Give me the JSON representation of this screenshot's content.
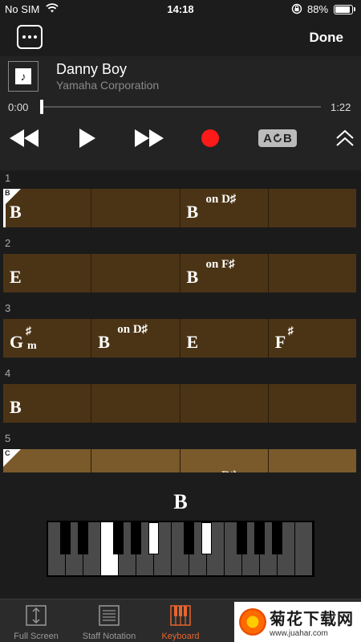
{
  "status_bar": {
    "carrier": "No SIM",
    "time": "14:18",
    "battery": "88%",
    "battery_level": 0.88
  },
  "nav": {
    "done_label": "Done"
  },
  "player": {
    "title": "Danny Boy",
    "artist": "Yamaha Corporation",
    "elapsed": "0:00",
    "total": "1:22",
    "progress": 0.0,
    "ab_label_a": "A",
    "ab_label_b": "B"
  },
  "chords": {
    "measures": [
      {
        "number": "1",
        "section": "B",
        "cells": [
          {
            "root": "B",
            "on": "",
            "accidental": "",
            "minor": false
          },
          {
            "root": "",
            "on": "",
            "accidental": "",
            "minor": false
          },
          {
            "root": "B",
            "on": "on D♯",
            "accidental": "",
            "minor": false
          },
          {
            "root": "",
            "on": "",
            "accidental": "",
            "minor": false
          }
        ]
      },
      {
        "number": "2",
        "section": "",
        "cells": [
          {
            "root": "E",
            "on": "",
            "accidental": "",
            "minor": false
          },
          {
            "root": "",
            "on": "",
            "accidental": "",
            "minor": false
          },
          {
            "root": "B",
            "on": "on F♯",
            "accidental": "",
            "minor": false
          },
          {
            "root": "",
            "on": "",
            "accidental": "",
            "minor": false
          }
        ]
      },
      {
        "number": "3",
        "section": "",
        "cells": [
          {
            "root": "G",
            "on": "",
            "accidental": "♯",
            "minor": true,
            "minor_label": "m"
          },
          {
            "root": "B",
            "on": "on D♯",
            "accidental": "",
            "minor": false
          },
          {
            "root": "E",
            "on": "",
            "accidental": "",
            "minor": false
          },
          {
            "root": "F",
            "on": "",
            "accidental": "♯",
            "minor": false
          }
        ]
      },
      {
        "number": "4",
        "section": "",
        "cells": [
          {
            "root": "B",
            "on": "",
            "accidental": "",
            "minor": false
          },
          {
            "root": "",
            "on": "",
            "accidental": "",
            "minor": false
          },
          {
            "root": "",
            "on": "",
            "accidental": "",
            "minor": false
          },
          {
            "root": "",
            "on": "",
            "accidental": "",
            "minor": false
          }
        ]
      },
      {
        "number": "5",
        "section": "C",
        "cells": [
          {
            "root": "",
            "on": "",
            "accidental": "",
            "minor": false
          },
          {
            "root": "",
            "on": "",
            "accidental": "",
            "minor": false
          },
          {
            "root": "",
            "on": "on D♯",
            "accidental": "",
            "minor": false
          },
          {
            "root": "",
            "on": "",
            "accidental": "",
            "minor": false
          }
        ]
      }
    ]
  },
  "keyboard": {
    "current_chord": "B",
    "white_keys_on": [
      3
    ],
    "black_keys_on": [
      4,
      6
    ]
  },
  "tabs": [
    {
      "label": "Full Screen",
      "icon": "full-screen-icon",
      "active": false
    },
    {
      "label": "Staff Notation",
      "icon": "staff-notation-icon",
      "active": false
    },
    {
      "label": "Keyboard",
      "icon": "keyboard-icon",
      "active": true
    }
  ],
  "watermark": {
    "text": "菊花下载网",
    "url": "www.juahar.com"
  },
  "colors": {
    "accent": "#e8652d",
    "record": "#ff1a1a",
    "chord_cell": "#4b3415"
  }
}
